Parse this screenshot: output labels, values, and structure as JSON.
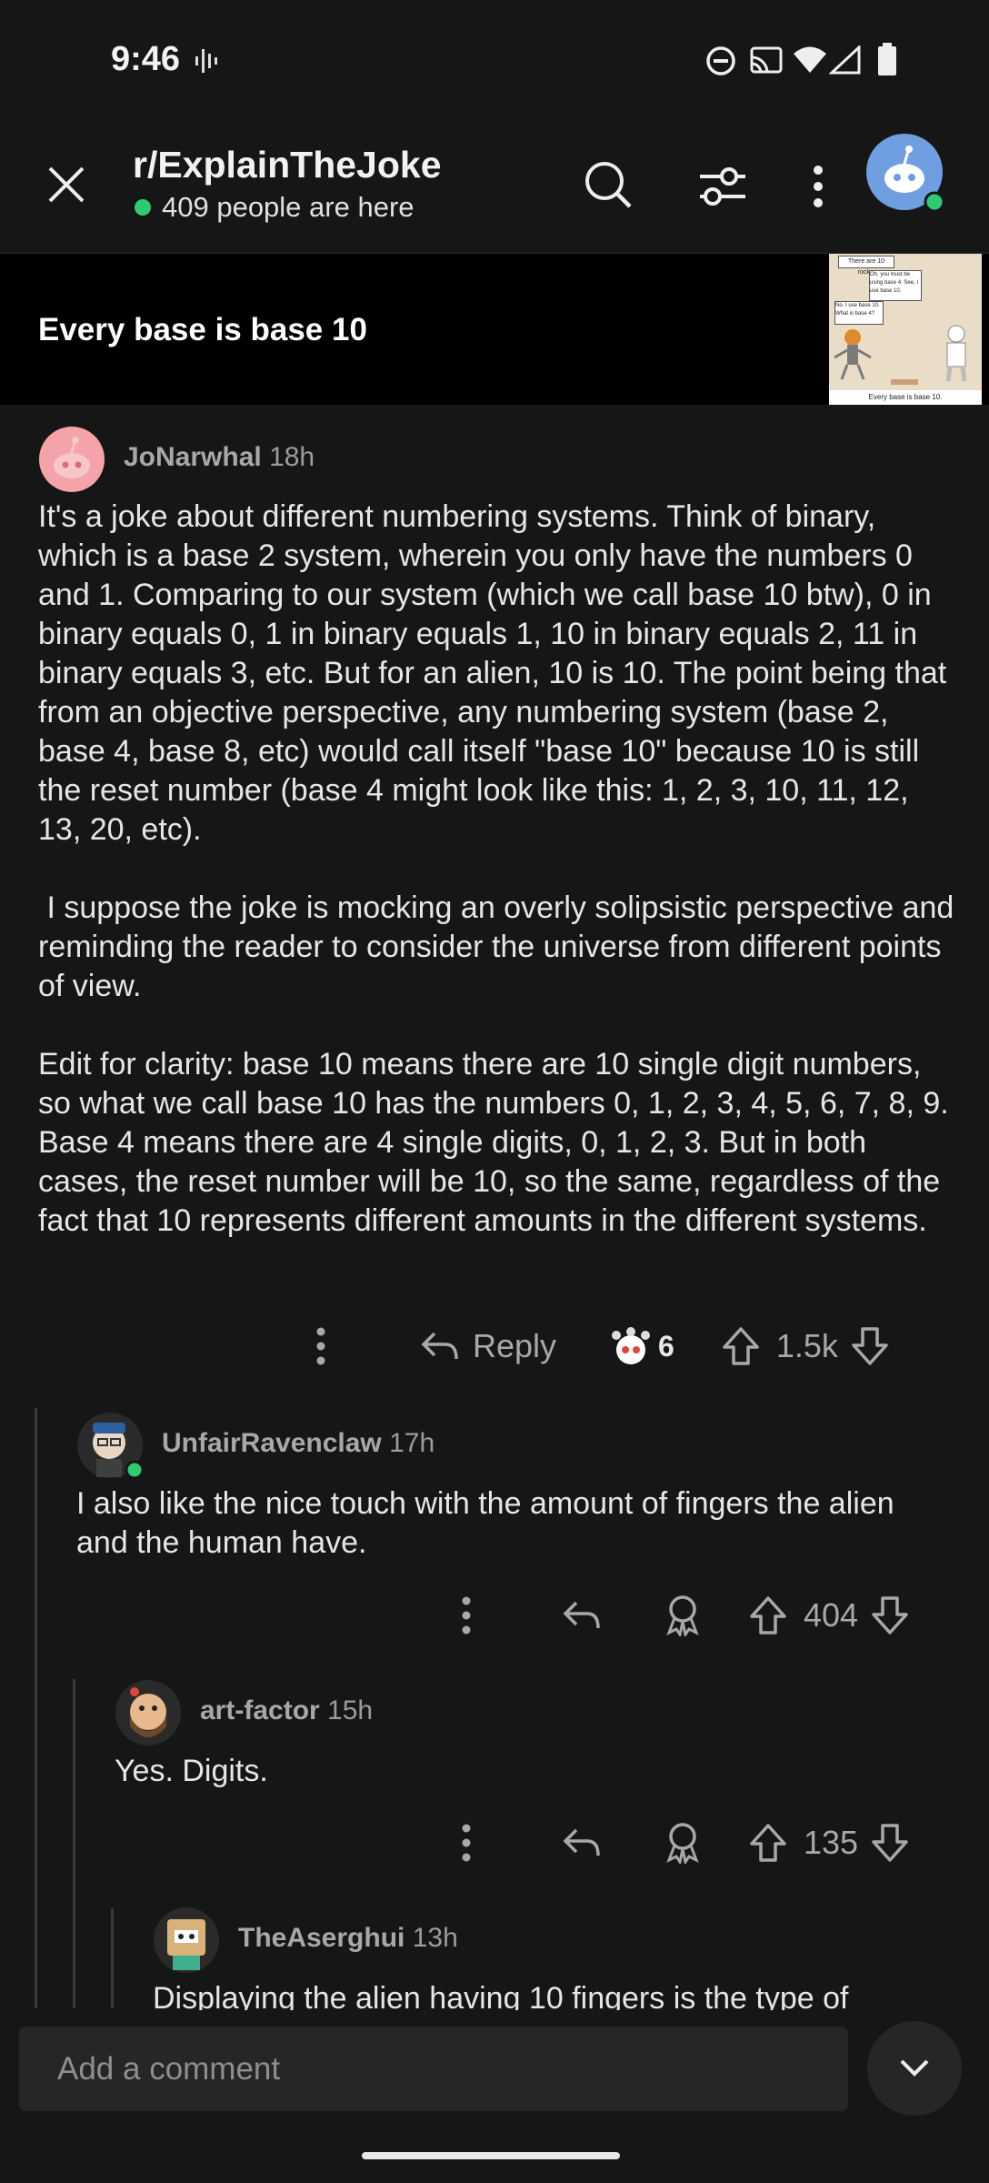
{
  "status_bar": {
    "time": "9:46"
  },
  "header": {
    "subreddit": "r/ExplainTheJoke",
    "presence": "409 people are here"
  },
  "post": {
    "title": "Every base is base 10",
    "thumbnail": {
      "speech_1": "There are 10 rocks.",
      "speech_2": "Oh, you must be using base 4. See, I use base 10.",
      "speech_3": "No. I use base 10. What is base 4?",
      "caption": "Every base is base 10."
    }
  },
  "comments": [
    {
      "author": "JoNarwhal",
      "age": "18h",
      "paragraphs": [
        "It's a joke about different numbering systems. Think of binary, which is a base 2 system, wherein you only have the numbers 0 and 1. Comparing to our system (which we call base 10 btw), 0 in binary equals 0, 1 in binary equals 1, 10 in binary equals 2, 11 in binary equals 3, etc. But for an alien, 10 is 10. The point being that from an objective perspective, any numbering system (base 2, base 4, base 8, etc) would call itself \"base 10\" because 10 is still the reset number (base 4 might look like this: 1, 2, 3, 10, 11, 12, 13, 20, etc).",
        " I suppose the joke is mocking an overly solipsistic perspective and reminding the reader to consider the universe from different points of view.",
        "Edit for clarity: base 10 means there are 10 single digit numbers, so what we call base 10 has the numbers 0, 1, 2, 3, 4, 5, 6, 7, 8, 9. Base 4 means there are 4 single digits, 0, 1, 2, 3. But in both cases, the reset number will be 10, so the same, regardless of the fact that 10 represents different amounts in the different systems."
      ],
      "reply_label": "Reply",
      "award_count": "6",
      "score": "1.5k"
    },
    {
      "author": "UnfairRavenclaw",
      "age": "17h",
      "text": "I also like the nice touch with the amount of fingers the alien and the human have.",
      "score": "404"
    },
    {
      "author": "art-factor",
      "age": "15h",
      "text": "Yes. Digits.",
      "score": "135"
    },
    {
      "author": "TheAserghui",
      "age": "13h",
      "text": "Displaying the alien having 10 fingers is the type of"
    }
  ],
  "composer": {
    "placeholder": "Add a comment"
  },
  "colors": {
    "background": "#161617",
    "online_green": "#2ecc71",
    "avatar_blue": "#6f9fe0",
    "avatar_pink": "#f4a3a8"
  }
}
